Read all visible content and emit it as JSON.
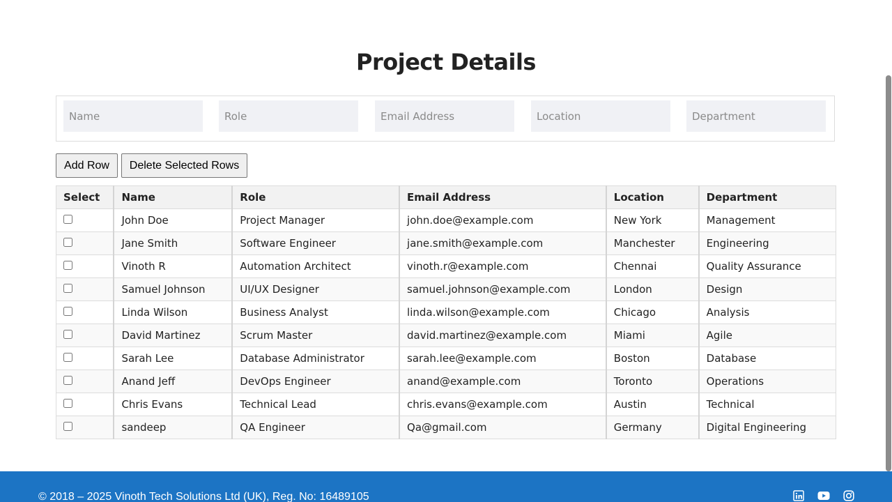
{
  "page": {
    "title": "Project Details"
  },
  "form": {
    "name_placeholder": "Name",
    "role_placeholder": "Role",
    "email_placeholder": "Email Address",
    "location_placeholder": "Location",
    "department_placeholder": "Department"
  },
  "actions": {
    "add_row": "Add Row",
    "delete_rows": "Delete Selected Rows"
  },
  "table": {
    "headers": [
      "Select",
      "Name",
      "Role",
      "Email Address",
      "Location",
      "Department"
    ],
    "rows": [
      {
        "name": "John Doe",
        "role": "Project Manager",
        "email": "john.doe@example.com",
        "location": "New York",
        "department": "Management",
        "selected": false
      },
      {
        "name": "Jane Smith",
        "role": "Software Engineer",
        "email": "jane.smith@example.com",
        "location": "Manchester",
        "department": "Engineering",
        "selected": false
      },
      {
        "name": "Vinoth R",
        "role": "Automation Architect",
        "email": "vinoth.r@example.com",
        "location": "Chennai",
        "department": "Quality Assurance",
        "selected": false
      },
      {
        "name": "Samuel Johnson",
        "role": "UI/UX Designer",
        "email": "samuel.johnson@example.com",
        "location": "London",
        "department": "Design",
        "selected": false
      },
      {
        "name": "Linda Wilson",
        "role": "Business Analyst",
        "email": "linda.wilson@example.com",
        "location": "Chicago",
        "department": "Analysis",
        "selected": false
      },
      {
        "name": "David Martinez",
        "role": "Scrum Master",
        "email": "david.martinez@example.com",
        "location": "Miami",
        "department": "Agile",
        "selected": false
      },
      {
        "name": "Sarah Lee",
        "role": "Database Administrator",
        "email": "sarah.lee@example.com",
        "location": "Boston",
        "department": "Database",
        "selected": false
      },
      {
        "name": "Anand Jeff",
        "role": "DevOps Engineer",
        "email": "anand@example.com",
        "location": "Toronto",
        "department": "Operations",
        "selected": false
      },
      {
        "name": "Chris Evans",
        "role": "Technical Lead",
        "email": "chris.evans@example.com",
        "location": "Austin",
        "department": "Technical",
        "selected": false
      },
      {
        "name": "sandeep",
        "role": "QA Engineer",
        "email": "Qa@gmail.com",
        "location": "Germany",
        "department": "Digital Engineering",
        "selected": false
      }
    ]
  },
  "footer": {
    "copyright": "© 2018 – 2025 Vinoth Tech Solutions Ltd (UK), Reg. No: 16489105",
    "social_icons": [
      "linkedin-icon",
      "youtube-icon",
      "instagram-icon"
    ]
  },
  "colors": {
    "footer_bg": "#1c74c4",
    "header_bg": "#f2f2f2",
    "input_bg": "#f0f1f5"
  }
}
